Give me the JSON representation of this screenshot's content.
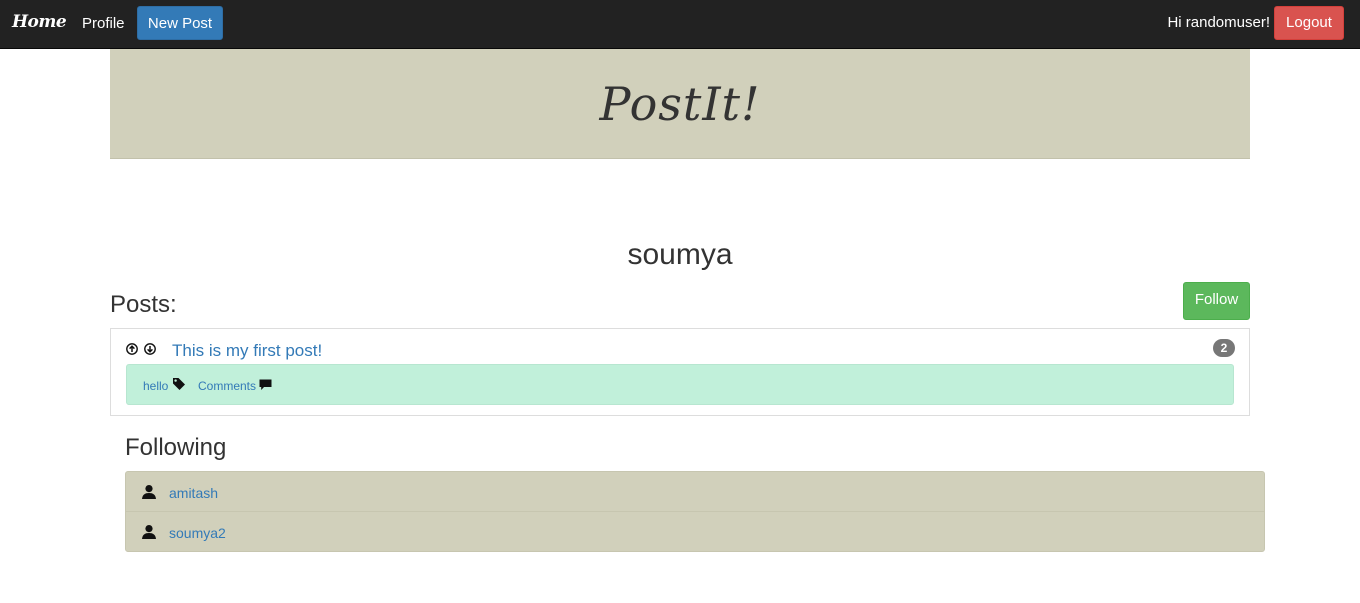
{
  "navbar": {
    "brand": "Home",
    "profile_link": "Profile",
    "new_post_button": "New Post",
    "greeting": "Hi randomuser!",
    "logout_button": "Logout"
  },
  "banner": {
    "title": "PostIt!"
  },
  "profile": {
    "username": "soumya",
    "posts_heading": "Posts:",
    "follow_button": "Follow"
  },
  "posts": [
    {
      "title": "This is my first post!",
      "score_badge": "2",
      "tag": "hello",
      "comments_label": "Comments"
    }
  ],
  "following": {
    "heading": "Following",
    "users": [
      "amitash",
      "soumya2"
    ]
  },
  "colors": {
    "navbar_bg": "#222222",
    "primary": "#337ab7",
    "danger": "#d9534f",
    "success": "#5cb85c",
    "banner_bg": "#d1d0bb",
    "post_meta_bg": "#c1f0da"
  }
}
